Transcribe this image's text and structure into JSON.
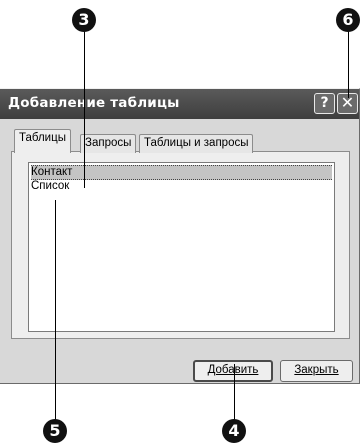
{
  "dialog": {
    "title": "Добавление таблицы",
    "help_glyph": "?",
    "close_glyph": "✕"
  },
  "tabs": [
    {
      "label": "Таблицы",
      "active": true
    },
    {
      "label": "Запросы",
      "active": false
    },
    {
      "label": "Таблицы и запросы",
      "active": false
    }
  ],
  "list": {
    "items": [
      {
        "label": "Контакт",
        "selected": true
      },
      {
        "label": "Список",
        "selected": false
      }
    ]
  },
  "buttons": {
    "add_label": "Добавить",
    "close_label": "Закрыть"
  },
  "callouts": [
    "3",
    "6",
    "5",
    "4"
  ],
  "colors": {
    "titlebar": "#4a4a4a",
    "dialog_bg": "#d8d8d8",
    "panel_bg": "#eeeeee",
    "selection": "#c4c4c4",
    "callout": "#111111"
  },
  "icons": {
    "help": "question-icon",
    "close": "close-icon"
  }
}
